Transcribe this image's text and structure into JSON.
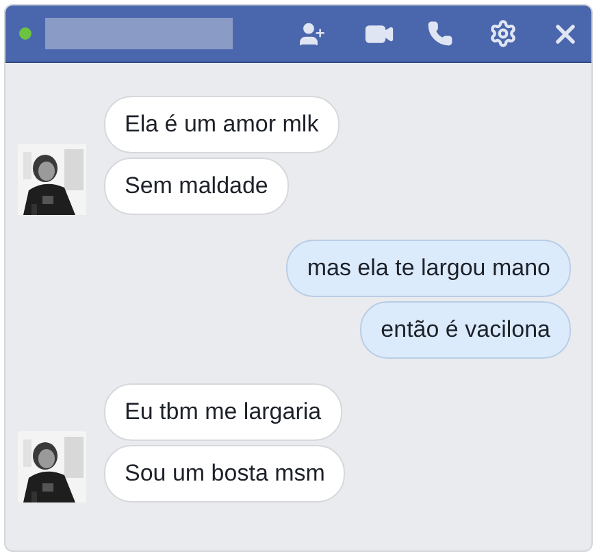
{
  "header": {
    "online": true
  },
  "groups": [
    {
      "kind": "received",
      "messages": [
        "Ela é um amor mlk",
        "Sem maldade"
      ]
    },
    {
      "kind": "sent",
      "messages": [
        "mas ela te largou mano",
        "então é vacilona"
      ]
    },
    {
      "kind": "received",
      "messages": [
        "Eu tbm me largaria",
        "Sou um bosta msm"
      ]
    }
  ]
}
